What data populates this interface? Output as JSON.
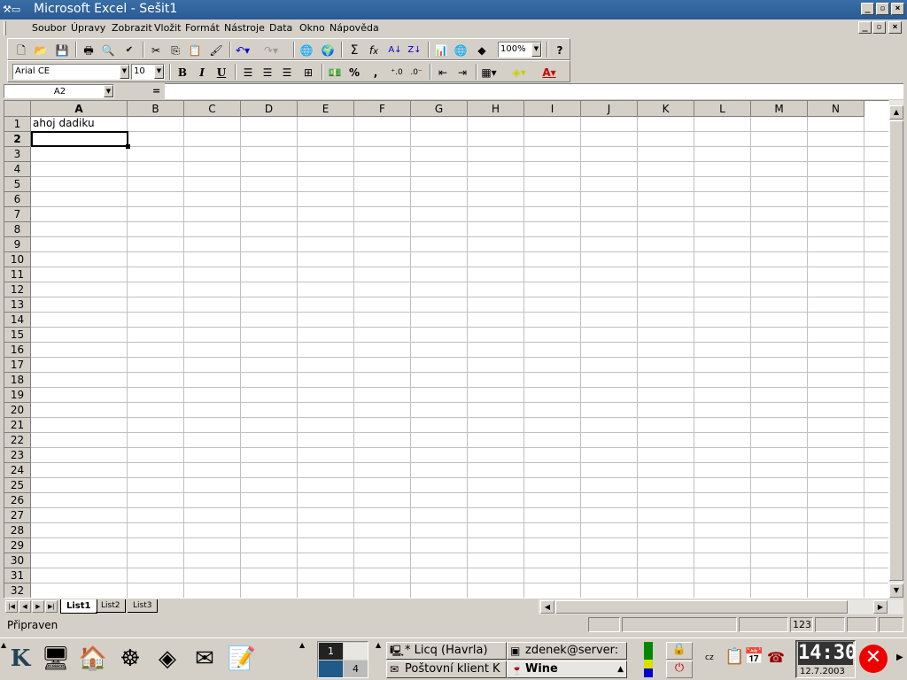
{
  "window": {
    "title": "Microsoft Excel - Sešit1",
    "app_icon": "excel-app-icon"
  },
  "menu": [
    "Soubor",
    "Úpravy",
    "Zobrazit",
    "Vložit",
    "Formát",
    "Nástroje",
    "Data",
    "Okno",
    "Nápověda"
  ],
  "standard_toolbar": {
    "icons": [
      "new-icon",
      "open-icon",
      "save-icon",
      "print-icon",
      "print-preview-icon",
      "spelling-icon",
      "cut-icon",
      "copy-icon",
      "paste-icon",
      "format-painter-icon",
      "undo-icon",
      "redo-icon",
      "hyperlink-icon",
      "web-toolbar-icon",
      "autosum-icon",
      "function-icon",
      "sort-ascending-icon",
      "sort-descending-icon",
      "chart-wizard-icon",
      "map-icon",
      "drawing-icon",
      "help-icon"
    ],
    "zoom": "100%"
  },
  "formatting_toolbar": {
    "font": "Arial CE",
    "size": "10",
    "bold": "B",
    "italic": "I",
    "underline": "U",
    "percent": "%",
    "comma": ","
  },
  "formula_bar": {
    "name_box": "A2",
    "equals": "=",
    "content": ""
  },
  "sheet": {
    "columns": [
      "A",
      "B",
      "C",
      "D",
      "E",
      "F",
      "G",
      "H",
      "I",
      "J",
      "K",
      "L",
      "M",
      "N"
    ],
    "rows": [
      "1",
      "2",
      "3",
      "4",
      "5",
      "6",
      "7",
      "8",
      "9",
      "10",
      "11",
      "12",
      "13",
      "14",
      "15",
      "16",
      "17",
      "18",
      "19",
      "20",
      "21",
      "22",
      "23",
      "24",
      "25",
      "26",
      "27",
      "28",
      "29",
      "30",
      "31",
      "32"
    ],
    "cells": {
      "A1": "ahoj dadiku"
    },
    "active_cell": "A2",
    "tabs": [
      "List1",
      "List2",
      "List3"
    ],
    "active_tab": "List1"
  },
  "status_bar": {
    "text": "Připraven",
    "num": "123"
  },
  "taskbar": {
    "desktops": [
      "1",
      "4"
    ],
    "tasks": [
      {
        "label": "* Licq (Havrla)",
        "icon": "licq-icon"
      },
      {
        "label": "zdenek@server:",
        "icon": "terminal-icon"
      },
      {
        "label": "Poštovní klient K",
        "icon": "mail-icon"
      },
      {
        "label": "Wine",
        "icon": "wine-icon"
      }
    ],
    "keyboard": "cz",
    "clock": "14:30",
    "date": "12.7.2003"
  }
}
